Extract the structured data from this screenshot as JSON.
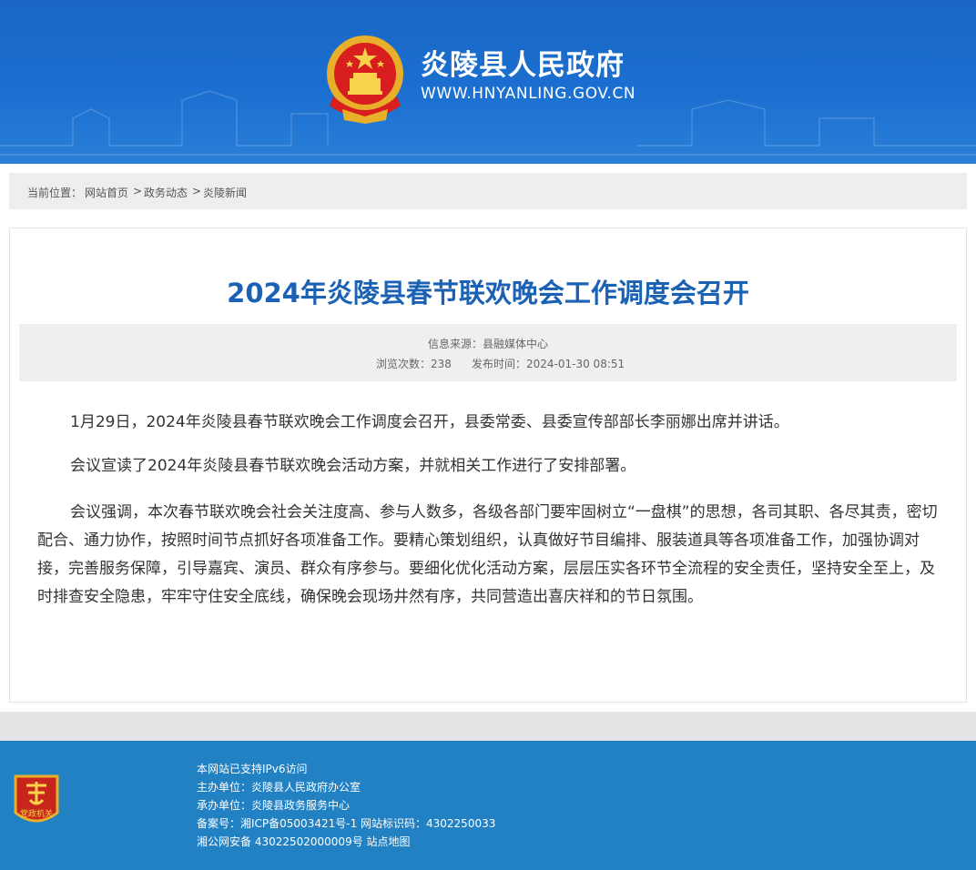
{
  "header": {
    "site_title": "炎陵县人民政府",
    "site_url": "WWW.HNYANLING.GOV.CN",
    "color": "#1a66c4"
  },
  "breadcrumb": {
    "label": "当前位置：",
    "items": [
      "网站首页",
      "政务动态",
      "炎陵新闻"
    ],
    "separator": ">"
  },
  "article": {
    "title": "2024年炎陵县春节联欢晚会工作调度会召开",
    "source": "信息来源：县融媒体中心",
    "views": "浏览次数：238",
    "published": "发布时间：2024-01-30 08:51",
    "paragraphs": [
      "1月29日，2024年炎陵县春节联欢晚会工作调度会召开，县委常委、县委宣传部部长李丽娜出席并讲话。",
      "会议宣读了2024年炎陵县春节联欢晚会活动方案，并就相关工作进行了安排部署。",
      "会议强调，本次春节联欢晚会社会关注度高、参与人数多，各级各部门要牢固树立“一盘棋”的思想，各司其职、各尽其责，密切配合、通力协作，按照时间节点抓好各项准备工作。要精心策划组织，认真做好节目编排、服装道具等各项准备工作，加强协调对接，完善服务保障，引导嘉宾、演员、群众有序参与。要细化优化活动方案，层层压实各环节全流程的安全责任，坚持安全至上，及时排查安全隐患，牢牢守住安全底线，确保晚会现场井然有序，共同营造出喜庆祥和的节日氛围。"
    ],
    "title_color": "#1b62b5"
  },
  "footer": {
    "badge_text": "党政机关",
    "lines": [
      "本网站已支持IPv6访问",
      "主办单位：炎陵县人民政府办公室",
      "承办单位：炎陵县政务服务中心",
      "备案号：湘ICP备05003421号-1 网站标识码：4302250033",
      "湘公网安备 43022502000009号 站点地图"
    ],
    "color": "#2181c3"
  }
}
